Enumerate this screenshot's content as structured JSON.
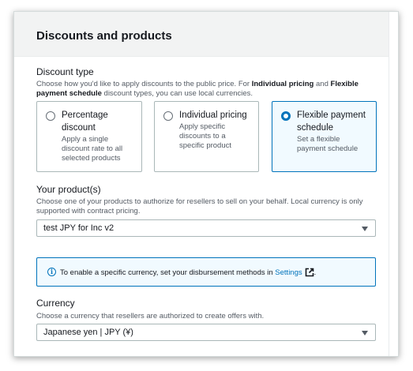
{
  "panel": {
    "title": "Discounts and products"
  },
  "discount_type": {
    "label": "Discount type",
    "desc_part1": "Choose how you'd like to apply discounts to the public price. For ",
    "desc_bold1": "Individual pricing",
    "desc_part2": " and ",
    "desc_bold2": "Flexible payment schedule",
    "desc_part3": " discount types, you can use local currencies.",
    "options": [
      {
        "title_line1": "Percentage",
        "title_line2": "discount",
        "desc_lines": [
          "Apply a single",
          "discount rate to all",
          "selected products"
        ],
        "selected": false
      },
      {
        "title_line1": "Individual pricing",
        "desc_lines": [
          "Apply specific",
          "discounts to a",
          "specific product"
        ],
        "selected": false
      },
      {
        "title_line1": "Flexible payment",
        "title_line2": "schedule",
        "desc_lines": [
          "Set a flexible",
          "payment schedule"
        ],
        "selected": true
      }
    ]
  },
  "products": {
    "label": "Your product(s)",
    "desc": "Choose one of your products to authorize for resellers to sell on your behalf. Local currency is only supported with contract pricing.",
    "selected_value": "test JPY for Inc v2"
  },
  "info": {
    "text": "To enable a specific currency, set your disbursement methods in ",
    "link": "Settings",
    "suffix": "."
  },
  "currency": {
    "label": "Currency",
    "desc": "Choose a currency that resellers are authorized to create offers with.",
    "selected_value": "Japanese yen | JPY (¥)"
  },
  "colors": {
    "accent": "#0073bb",
    "selected_tile_bg": "#f1faff",
    "header_bg": "#f2f3f3"
  }
}
